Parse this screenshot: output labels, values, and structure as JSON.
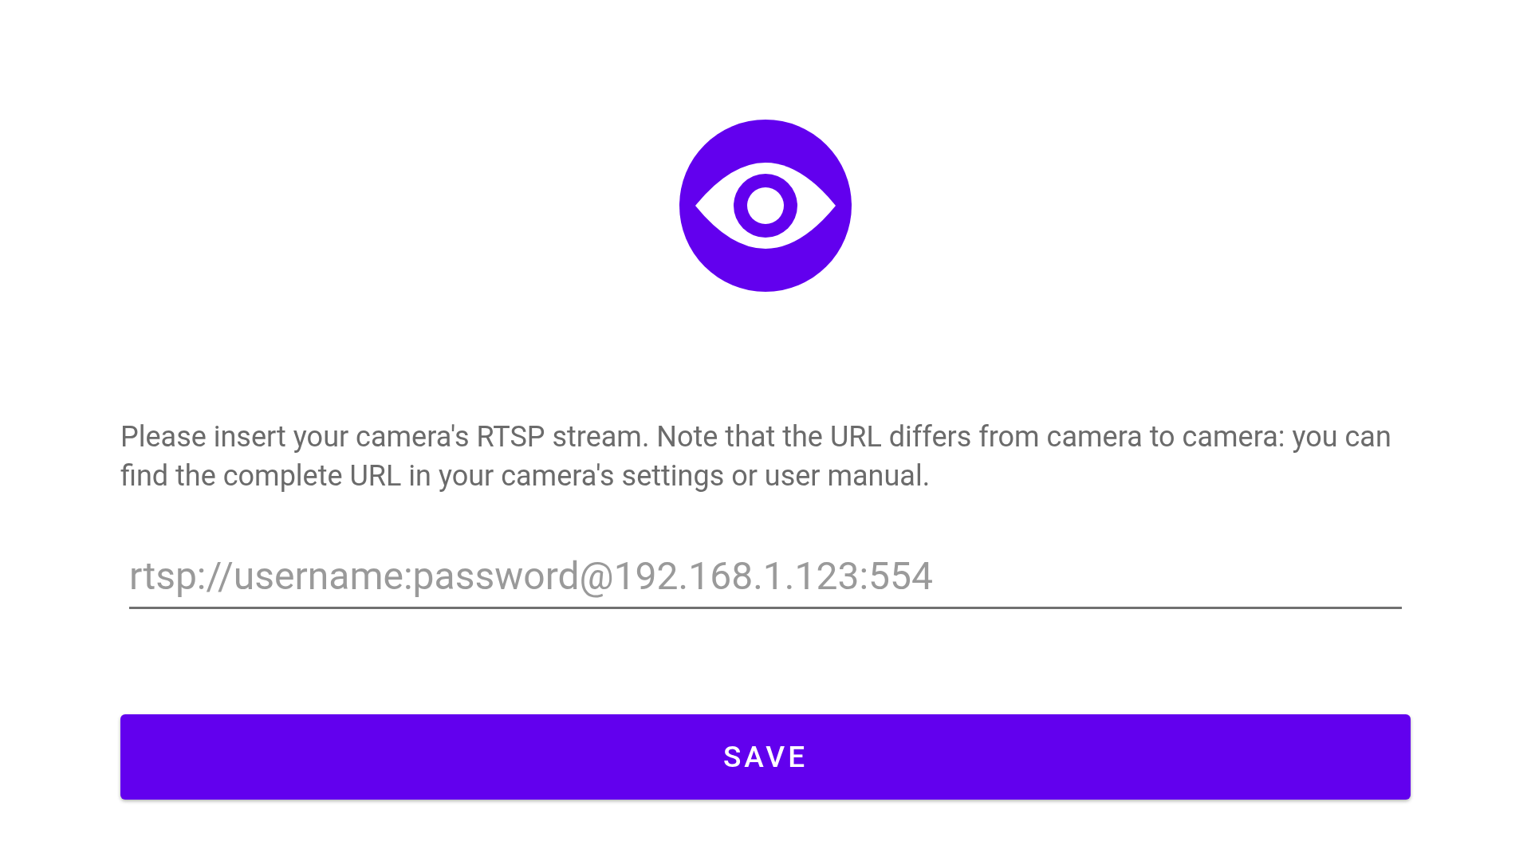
{
  "instructions": "Please insert your camera's RTSP stream. Note that the URL differs from camera to camera: you can find the complete URL in your camera's settings or user manual.",
  "stream_field": {
    "placeholder": "rtsp://username:password@192.168.1.123:554"
  },
  "save_button": {
    "label": "SAVE"
  }
}
